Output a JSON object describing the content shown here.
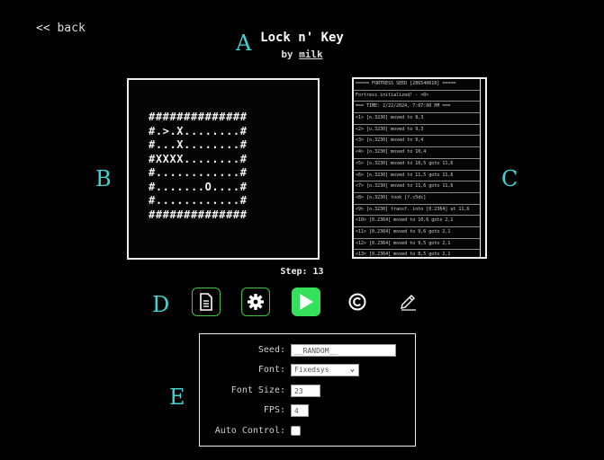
{
  "nav": {
    "back_label": "<< back"
  },
  "header": {
    "title": "Lock n' Key",
    "by_prefix": "by",
    "author": "milk"
  },
  "letters": {
    "a": "A",
    "b": "B",
    "c": "C",
    "d": "D",
    "e": "E"
  },
  "board": {
    "rows": [
      "##############",
      "#.>.X........#",
      "#...X........#",
      "#XXXX........#",
      "#............#",
      "#.......O....#",
      "#............#",
      "##############"
    ]
  },
  "log": {
    "rows": [
      "===== FORTRESS SEED [286540610] =====",
      "Fortress initialized! - <0>",
      "=== TIME: 2/22/2024, 7:07:00 PM ===",
      "<1> [o.3230] moved to 8,3",
      "<2> [o.3230] moved to 9,3",
      "<3> [o.3230] moved to 9,4",
      "<4> [o.3230] moved to 10,4",
      "<5> [o.3230] moved to 10,5 goto 11,6",
      "<6> [o.3230] moved to 11,5 goto 11,6",
      "<7> [o.3230] moved to 11,6 goto 11,6",
      "<8> [o.3230] took [?.c5dc]",
      "<9> [o.3230] transf. into [0.2364] at 11,6",
      "<10> [0.2364] moved to 10,6 goto 2,1",
      "<11> [0.2364] moved to 9,6 goto 2,1",
      "<12> [0.2364] moved to 9,5 goto 2,1",
      "<13> [0.2364] moved to 8,5 goto 2,1"
    ]
  },
  "status": {
    "step_label": "Step: 13"
  },
  "toolbar": {
    "icons": [
      "document-icon",
      "gear-icon",
      "play-icon",
      "copyright-icon",
      "pencil-icon"
    ],
    "accent": "#37e05a"
  },
  "settings": {
    "seed_label": "Seed:",
    "seed_value": "__RANDOM__",
    "font_label": "Font:",
    "font_value": "Fixedsys",
    "font_size_label": "Font Size:",
    "font_size_value": "23",
    "fps_label": "FPS:",
    "fps_value": "4",
    "auto_control_label": "Auto Control:"
  },
  "colors": {
    "letter": "#3fd5d5",
    "accent": "#37e05a",
    "outline": "#3fc53f"
  }
}
